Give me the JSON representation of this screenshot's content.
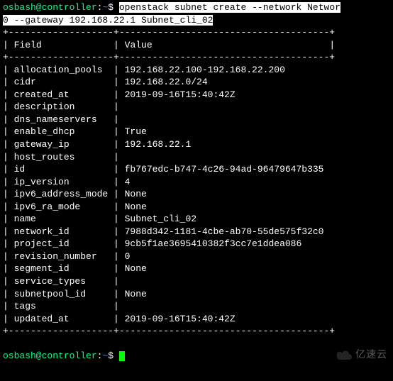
{
  "prompt": {
    "user_host": "osbash@controller",
    "path": "~",
    "symbol": "$"
  },
  "command": {
    "line1": "openstack subnet create --network Networ",
    "line2": "0 --gateway 192.168.22.1 Subnet_cli_02"
  },
  "table": {
    "header_field": "Field",
    "header_value": "Value",
    "rows": [
      {
        "field": "allocation_pools",
        "value": "192.168.22.100-192.168.22.200"
      },
      {
        "field": "cidr",
        "value": "192.168.22.0/24"
      },
      {
        "field": "created_at",
        "value": "2019-09-16T15:40:42Z"
      },
      {
        "field": "description",
        "value": ""
      },
      {
        "field": "dns_nameservers",
        "value": ""
      },
      {
        "field": "enable_dhcp",
        "value": "True"
      },
      {
        "field": "gateway_ip",
        "value": "192.168.22.1"
      },
      {
        "field": "host_routes",
        "value": ""
      },
      {
        "field": "id",
        "value": "fb767edc-b747-4c26-94ad-96479647b335"
      },
      {
        "field": "ip_version",
        "value": "4"
      },
      {
        "field": "ipv6_address_mode",
        "value": "None"
      },
      {
        "field": "ipv6_ra_mode",
        "value": "None"
      },
      {
        "field": "name",
        "value": "Subnet_cli_02"
      },
      {
        "field": "network_id",
        "value": "7988d342-1181-4cbe-ab70-55de575f32c0"
      },
      {
        "field": "project_id",
        "value": "9cb5f1ae3695410382f3cc7e1ddea086"
      },
      {
        "field": "revision_number",
        "value": "0"
      },
      {
        "field": "segment_id",
        "value": "None"
      },
      {
        "field": "service_types",
        "value": ""
      },
      {
        "field": "subnetpool_id",
        "value": "None"
      },
      {
        "field": "tags",
        "value": ""
      },
      {
        "field": "updated_at",
        "value": "2019-09-16T15:40:42Z"
      }
    ],
    "border_top": "+-------------------+--------------------------------------+",
    "border_mid": "+-------------------+--------------------------------------+",
    "border_bottom": "+-------------------+--------------------------------------+"
  },
  "watermark": "亿速云"
}
